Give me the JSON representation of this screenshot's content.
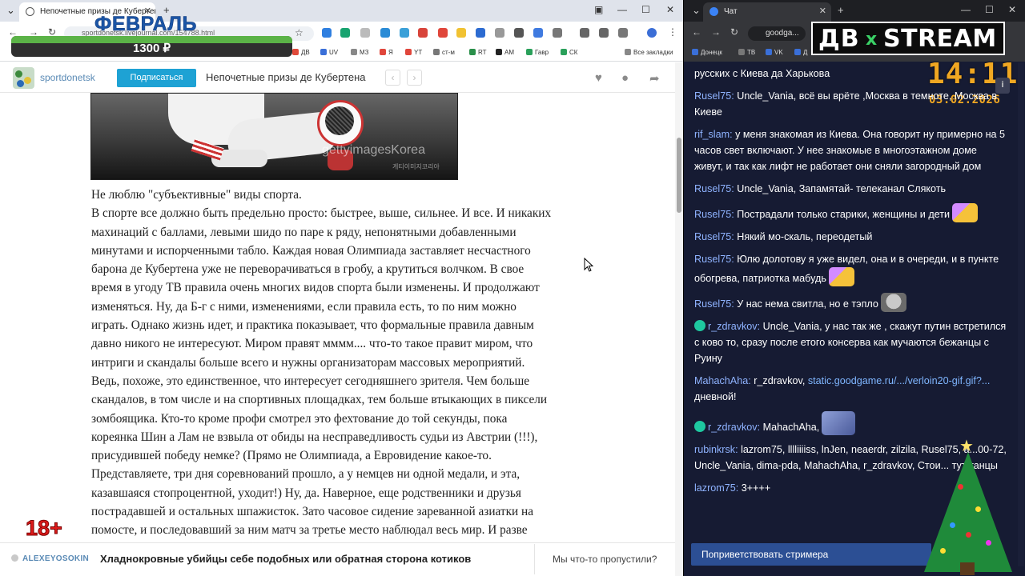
{
  "left_browser": {
    "tab_title": "Непочетные призы де Кубертена",
    "omnibox_text": "sportdonetsk.livejournal.com/154788.html",
    "bookmarks": [
      "ДВ",
      "UV",
      "МЗ",
      "Я",
      "YT",
      "ст-м",
      "RT",
      "АМ",
      "Гавр",
      "СК",
      "Все закладки"
    ]
  },
  "overlay": {
    "month": "ФЕВРАЛЬ",
    "donation_amount": "1300 ₽",
    "donation_progress_percent": 100,
    "age_rating": "18+"
  },
  "page_header": {
    "site_name": "sportdonetsk",
    "subscribe_label": "Подписаться",
    "post_title": "Непочетные призы де Кубертена"
  },
  "photo": {
    "watermark": "gettyimagesKorea",
    "watermark_sub": "게티이미지코리아"
  },
  "article_lines": [
    "Не люблю \"субъективные\" виды спорта.",
    "В спорте все должно быть предельно просто: быстрее, выше, сильнее. И все. И никаких",
    "махинаций с баллами, левыми шидо по паре к ряду, непонятными добавленными",
    "минутами и испорченными табло. Каждая новая Олимпиада заставляет несчастного",
    "барона де Кубертена уже не переворачиваться в гробу, а крутиться волчком. В свое",
    "время в угоду ТВ правила очень многих видов спорта были изменены. И продолжают",
    "изменяться. Ну, да Б-г с ними, изменениями, если правила есть, то по ним можно",
    "играть. Однако жизнь идет, и практика показывает, что формальные правила давным",
    "давно никого не интересуют. Миром правят мммм.... что-то такое правит миром, что",
    "интриги и скандалы больше всего и нужны организаторам массовых мероприятий.",
    "Ведь, похоже, это единственное, что интересует сегодняшнего зрителя. Чем больше",
    "скандалов, в том числе и на спортивных площадках, тем больше втыкающих в пиксели",
    "зомбоящика. Кто-то кроме профи смотрел это фехтование до той секунды, пока",
    "кореянка Шин а Лам не взвыла от обиды на несправедливость судьи из Австрии (!!!),",
    "присудившей победу немке? (Прямо не Олимпиада, а Евровидение какое-то.",
    "Представляете, три дня соревнований прошло, а у немцев ни одной медали, и эта,",
    "казавшаяся стопроцентной, уходит!) Ну, да. Наверное, еще родственники и друзья",
    "пострадавшей и остальных шпажисток. Зато часовое сидение зареванной азиатки на",
    "помосте, и последовавший за ним матч за третье место наблюдал весь мир. И разве"
  ],
  "footer": {
    "author": "ALEXEYOSOKIN",
    "post_title": "Хладнокровные убийцы себе подобных или обратная сторона котиков",
    "missed_label": "Мы что-то пропустили?"
  },
  "right_browser": {
    "tab_title": "Чат",
    "omnibox_text": "goodga...",
    "bookmarks": [
      "Донецк",
      "ТВ",
      "VK",
      "Д"
    ]
  },
  "stream_logo": {
    "left": "ДВ",
    "x": "x",
    "right": "STREAM"
  },
  "clock": {
    "time": "14:11",
    "date": "03.02.2026"
  },
  "chat_messages": [
    {
      "nick": "",
      "text": "русских с Киева да Харькова"
    },
    {
      "nick": "Rusel75:",
      "text": " Uncle_Vania, всё вы врёте ,Москва в темноте, Москва в Киеве"
    },
    {
      "nick": "rif_slam:",
      "text": " у меня знакомая из Киева. Она говорит ну примерно на 5 часов свет включают. У нее знакомые в многоэтажном доме живут, и так как лифт не работает они сняли загородный дом"
    },
    {
      "nick": "Rusel75:",
      "text": " Uncle_Vania, Запамятай- телеканал Слякоть"
    },
    {
      "nick": "Rusel75:",
      "text": " Пострадали только старики, женщины и дети"
    },
    {
      "nick": "Rusel75:",
      "text": " Някий мо-скаль, переодетый"
    },
    {
      "nick": "Rusel75:",
      "text": " Юлю долотову я уже видел, она и в очереди, и в пункте обогрева, патриотка мабудь"
    },
    {
      "nick": "Rusel75:",
      "text": " У нас нема свитла, но е тэпло"
    },
    {
      "nick": "r_zdravkov:",
      "text": " Uncle_Vania, у нас так же , скажут путин встретился с ково то, сразу после етого консерва как мучаются бежанцы с Руину"
    },
    {
      "nick": "MahachAha:",
      "text": " r_zdravkov, ",
      "link": "static.goodgame.ru/.../verloin20-gif.gif?...",
      "after": " дневной!"
    },
    {
      "nick": "r_zdravkov:",
      "text": " MahachAha,"
    },
    {
      "nick": "rubinkrsk:",
      "text": " lazrom75, lllliiiiss, lnJen, neaerdr, zilzila, Rusel75, a...00-72, Uncle_Vania, dima-pda, MahachAha, r_zdravkov, Стои... тут танцы"
    },
    {
      "nick": "lazrom75:",
      "text": " 3++++"
    }
  ],
  "greet_button": "Поприветствовать стримера"
}
